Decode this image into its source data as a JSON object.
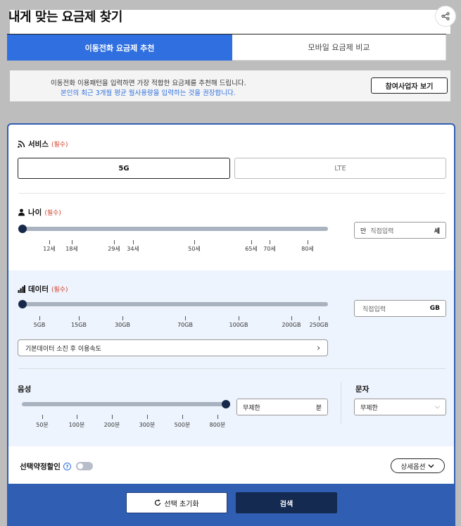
{
  "page": {
    "title": "내게 맞는 요금제 찾기"
  },
  "tabs": [
    {
      "label": "이동전화 요금제 추천",
      "active": true
    },
    {
      "label": "모바일 요금제 비교",
      "active": false
    }
  ],
  "notice": {
    "line1": "이동전화 이용패턴을 입력하면 가장 적합한 요금제를 추천해 드립니다.",
    "line2": "본인의 최근 3개월 평균 월사용량을 입력하는 것을 권장합니다.",
    "button": "참여사업자 보기"
  },
  "required_label": "(필수)",
  "service": {
    "label": "서비스",
    "options": [
      "5G",
      "LTE"
    ],
    "selected": "5G"
  },
  "age": {
    "label": "나이",
    "ticks": [
      "12세",
      "18세",
      "29세",
      "34세",
      "50세",
      "65세",
      "70세",
      "80세"
    ],
    "input_prefix": "만",
    "input_placeholder": "직접입력",
    "input_unit": "세"
  },
  "data": {
    "label": "데이터",
    "ticks": [
      "5GB",
      "15GB",
      "30GB",
      "70GB",
      "100GB",
      "200GB",
      "250GB"
    ],
    "input_placeholder": "직접입력",
    "input_unit": "GB",
    "speed_button": "기본데이터 소진 후 이용속도"
  },
  "voice": {
    "label": "음성",
    "ticks": [
      "50분",
      "100분",
      "200분",
      "300분",
      "500분",
      "800분"
    ],
    "input_value": "무제한",
    "input_unit": "분",
    "level": 1.0
  },
  "sms": {
    "label": "문자",
    "selected": "무제한"
  },
  "discount": {
    "label": "선택약정할인",
    "help": "?",
    "enabled": false
  },
  "detail_button": "상세옵션",
  "footer": {
    "reset": "선택 초기화",
    "search": "검색"
  },
  "colors": {
    "primary": "#2f6fe0",
    "panel_border": "#2f5eb3",
    "dark_navy": "#142a50",
    "required": "#d0412b"
  }
}
